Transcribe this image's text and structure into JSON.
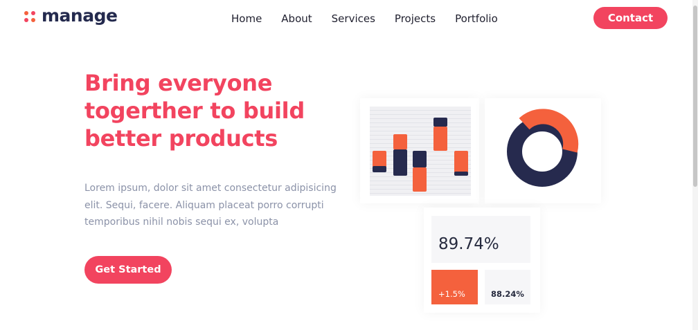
{
  "header": {
    "logo_text": "manage",
    "logo_icon": "four-dots-logo-icon",
    "nav": [
      {
        "label": "Home"
      },
      {
        "label": "About"
      },
      {
        "label": "Services"
      },
      {
        "label": "Projects"
      },
      {
        "label": "Portfolio"
      }
    ],
    "contact_label": "Contact"
  },
  "hero": {
    "title": "Bring everyone togerther to build better products",
    "text": "Lorem ipsum, dolor sit amet consectetur adipisicing elit. Sequi, facere. Aliquam placeat porro corrupti temporibus nihil nobis sequi ex, volupta",
    "cta_label": "Get Started"
  },
  "stats": {
    "main_value": "89.74%",
    "change_value": "+1.5%",
    "secondary_value": "88.24%"
  },
  "colors": {
    "accent": "#f2445f",
    "orange": "#f4613d",
    "navy": "#262a4e",
    "text_muted": "#8b92a8"
  }
}
